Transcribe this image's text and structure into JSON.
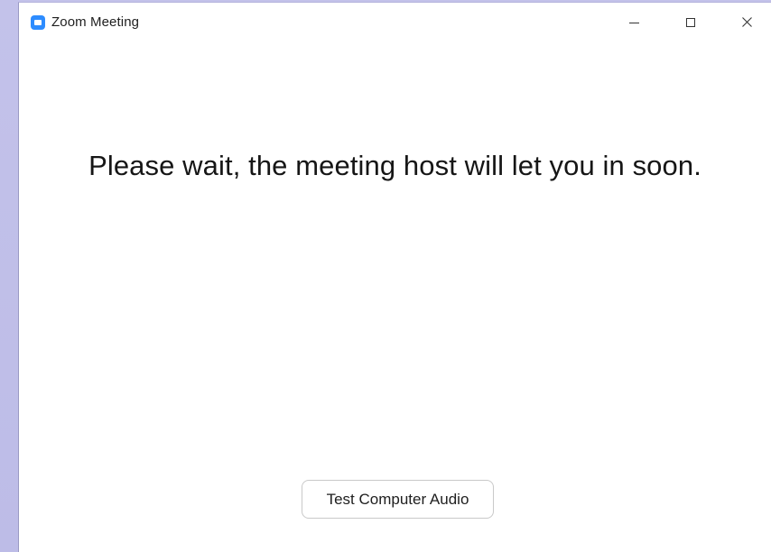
{
  "window": {
    "title": "Zoom Meeting",
    "app_icon": "zoom-logo-icon",
    "controls": {
      "minimize": "minimize-icon",
      "maximize": "maximize-icon",
      "close": "close-icon"
    }
  },
  "main": {
    "waiting_message": "Please wait, the meeting host will let you in soon.",
    "test_audio_button": "Test Computer Audio"
  },
  "colors": {
    "background": "#c3c2ea",
    "window": "#ffffff",
    "accent": "#2d8cff"
  }
}
